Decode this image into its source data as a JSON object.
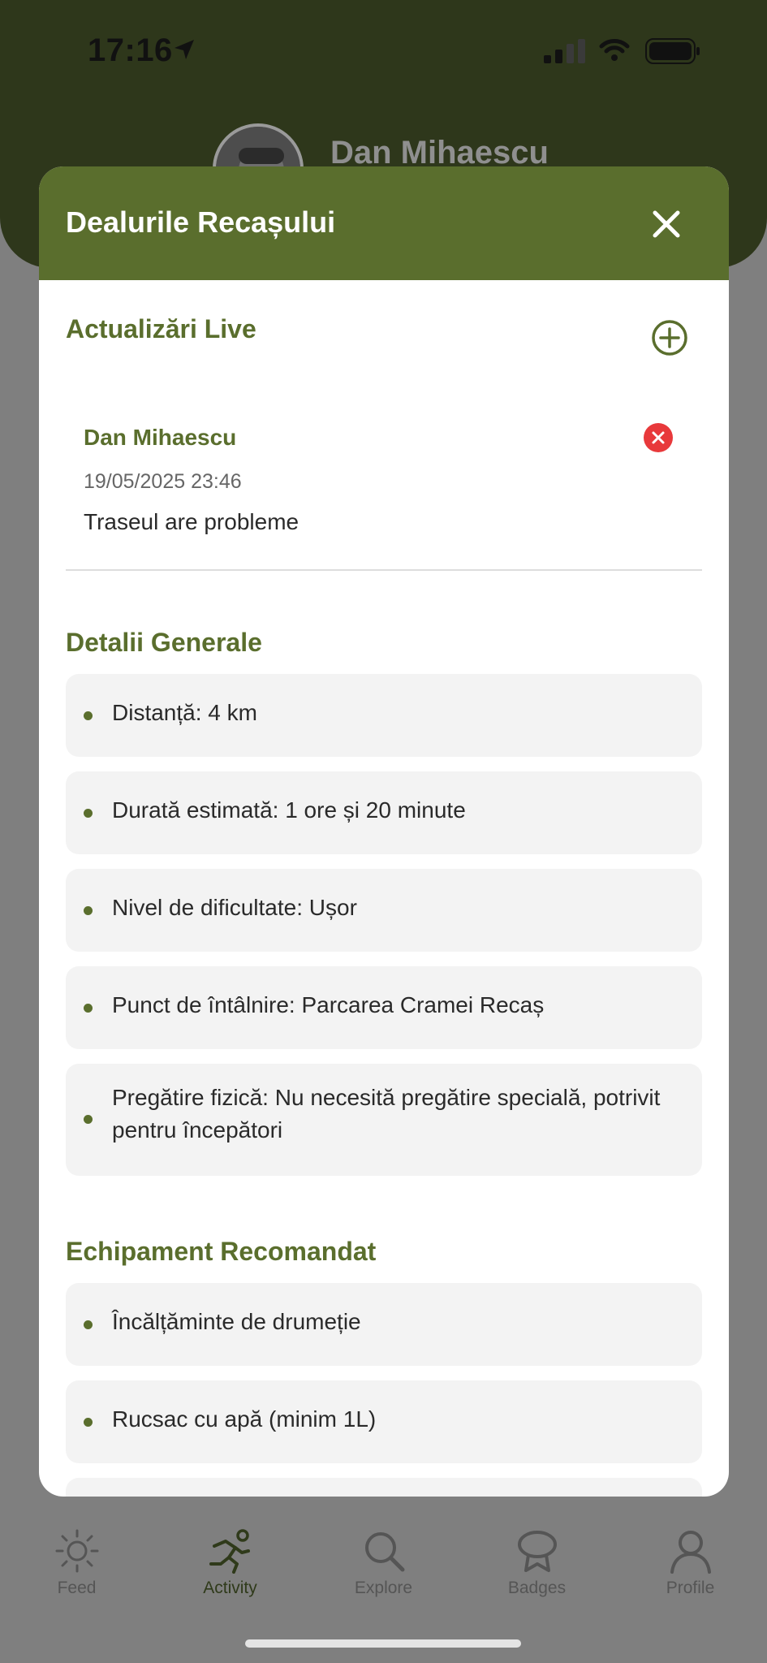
{
  "status": {
    "time": "17:16"
  },
  "header": {
    "user_name": "Dan Mihaescu"
  },
  "modal": {
    "title": "Dealurile Recașului",
    "live_updates": {
      "title": "Actualizări Live",
      "items": [
        {
          "author": "Dan Mihaescu",
          "date": "19/05/2025 23:46",
          "text": "Traseul are probleme"
        }
      ]
    },
    "general": {
      "title": "Detalii Generale",
      "items": [
        "Distanță: 4 km",
        "Durată estimată: 1 ore și 20 minute",
        "Nivel de dificultate: Ușor",
        "Punct de întâlnire: Parcarea Cramei Recaș",
        "Pregătire fizică: Nu necesită pregătire specială, potrivit pentru începători"
      ]
    },
    "equipment": {
      "title": "Echipament Recomandat",
      "items": [
        "Încălțăminte de drumeție",
        "Rucsac cu apă (minim 1L)"
      ]
    }
  },
  "tabs": [
    {
      "label": "Feed",
      "icon": "sun-icon"
    },
    {
      "label": "Activity",
      "icon": "running-icon",
      "active": true
    },
    {
      "label": "Explore",
      "icon": "search-icon"
    },
    {
      "label": "Badges",
      "icon": "badge-icon"
    },
    {
      "label": "Profile",
      "icon": "profile-icon"
    }
  ],
  "colors": {
    "accent": "#5a6e2d",
    "header_dark": "#2e371b",
    "danger": "#e8393b"
  }
}
